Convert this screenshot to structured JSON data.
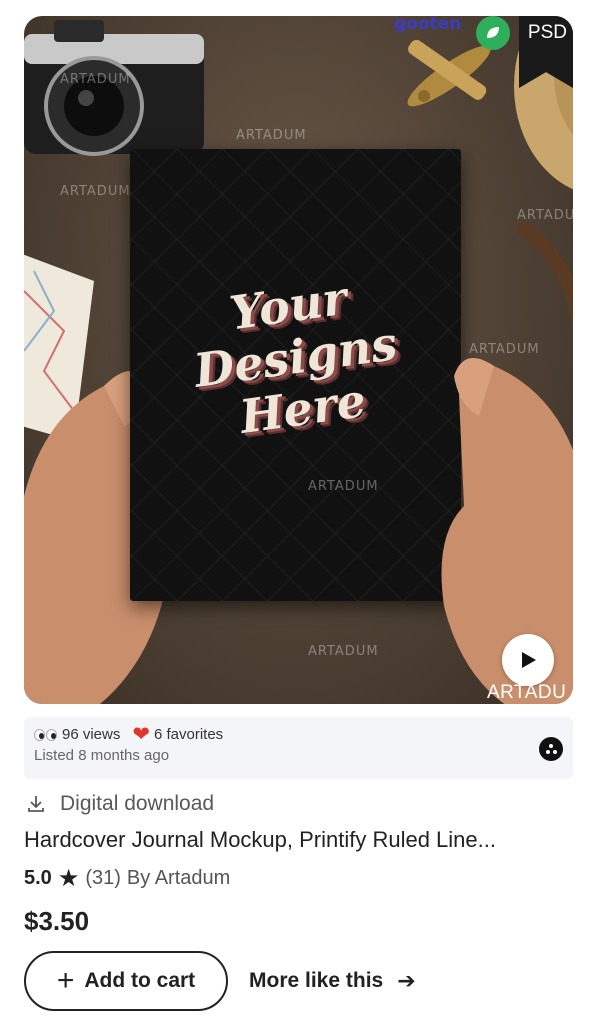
{
  "listing_image": {
    "book_text": "Your Designs Here",
    "badge": "PSD",
    "brand_logo_text": "gooten",
    "watermark": "ARTADUM",
    "bottom_watermark": "ARTADU"
  },
  "stats": {
    "views": "96 views",
    "favorites": "6 favorites",
    "listed": "Listed 8 months ago"
  },
  "product": {
    "type_label": "Digital download",
    "title": "Hardcover Journal Mockup, Printify Ruled Line...",
    "rating": "5.0",
    "review_count": "(31)",
    "seller": "By Artadum",
    "price": "$3.50"
  },
  "actions": {
    "add_to_cart": "Add to cart",
    "more_like_this": "More like this"
  },
  "colors": {
    "accent": "#222222",
    "heart": "#e0362c",
    "stats_bg": "#f4f5f8"
  }
}
